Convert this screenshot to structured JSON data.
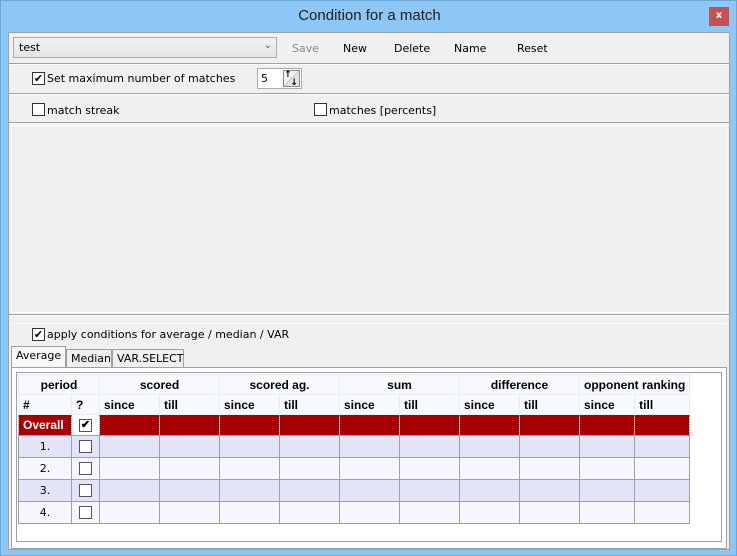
{
  "window": {
    "title": "Condition for a match",
    "close_label": "x"
  },
  "toolbar": {
    "profile_value": "test",
    "buttons": [
      {
        "label": "Save",
        "enabled": false
      },
      {
        "label": "New",
        "enabled": true
      },
      {
        "label": "Delete",
        "enabled": true
      },
      {
        "label": "Name",
        "enabled": true
      },
      {
        "label": "Reset",
        "enabled": true
      }
    ]
  },
  "options": {
    "max_matches_label": "Set maximum number of matches",
    "max_matches_checked": true,
    "max_matches_value": "5",
    "match_streak_label": "match streak",
    "match_streak_checked": false,
    "matches_percents_label": "matches [percents]",
    "matches_percents_checked": false,
    "apply_label": "apply conditions for average / median / VAR",
    "apply_checked": true
  },
  "tabs": [
    {
      "label": "Average",
      "active": true
    },
    {
      "label": "Median",
      "active": false
    },
    {
      "label": "VAR.SELECT",
      "active": false
    }
  ],
  "grid": {
    "group_headers": [
      "period",
      "scored",
      "scored ag.",
      "sum",
      "difference",
      "opponent ranking"
    ],
    "sub_headers": [
      "#",
      "?",
      "since",
      "till",
      "since",
      "till",
      "since",
      "till",
      "since",
      "till",
      "since",
      "till"
    ],
    "rows": [
      {
        "label": "Overall",
        "checked": true,
        "selected": true
      },
      {
        "label": "1.",
        "checked": false,
        "selected": false
      },
      {
        "label": "2.",
        "checked": false,
        "selected": false
      },
      {
        "label": "3.",
        "checked": false,
        "selected": false
      },
      {
        "label": "4.",
        "checked": false,
        "selected": false
      }
    ]
  },
  "colors": {
    "titlebar": "#8cc7f5",
    "close": "#c75050",
    "selected_row": "#a60000"
  }
}
